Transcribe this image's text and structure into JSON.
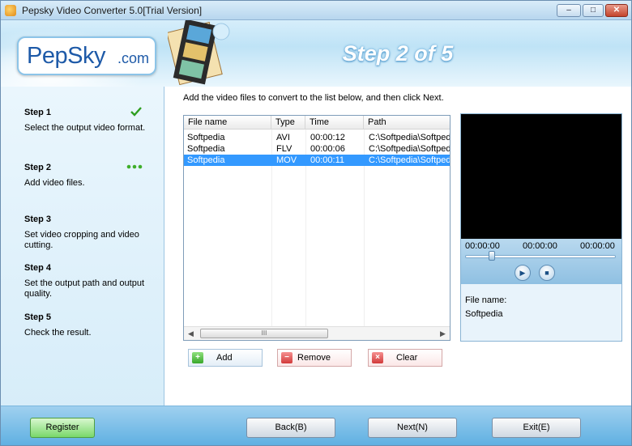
{
  "window": {
    "title": "Pepsky Video Converter 5.0[Trial Version]",
    "controls": {
      "minimize": "–",
      "maximize": "□",
      "close": "✕"
    }
  },
  "banner": {
    "logo": "PepSky",
    "logo_suffix": ".com",
    "step_title": "Step 2 of 5"
  },
  "steps": [
    {
      "title": "Step 1",
      "desc": "Select the output video format.",
      "status_icon": "check-icon"
    },
    {
      "title": "Step 2",
      "desc": "Add video files.",
      "status_icon": "in-progress-dots-icon"
    },
    {
      "title": "Step 3",
      "desc": "Set video cropping and video cutting."
    },
    {
      "title": "Step 4",
      "desc": "Set the output path and output quality."
    },
    {
      "title": "Step 5",
      "desc": "Check the result."
    }
  ],
  "main": {
    "instruction": "Add the video files to convert to the list below, and then click Next.",
    "columns": [
      "File name",
      "Type",
      "Time",
      "Path"
    ],
    "rows": [
      {
        "name": "Softpedia",
        "type": "AVI",
        "time": "00:00:12",
        "path": "C:\\Softpedia\\Softpedia.avi"
      },
      {
        "name": "Softpedia",
        "type": "FLV",
        "time": "00:00:06",
        "path": "C:\\Softpedia\\Softpedia.flv"
      },
      {
        "name": "Softpedia",
        "type": "MOV",
        "time": "00:00:11",
        "path": "C:\\Softpedia\\Softpedia.mov"
      }
    ],
    "scroll_thumb_grip": "III",
    "add_label": "Add",
    "remove_label": "Remove",
    "clear_label": "Clear"
  },
  "player": {
    "time_start": "00:00:00",
    "time_current": "00:00:00",
    "time_end": "00:00:00",
    "play_icon": "play-icon",
    "stop_icon": "stop-icon",
    "file_label": "File name:",
    "file_value": "Softpedia"
  },
  "footer": {
    "register_label": "Register",
    "back_label": "Back(B)",
    "next_label": "Next(N)",
    "exit_label": "Exit(E)"
  },
  "colors": {
    "selection": "#3399ff",
    "banner": "#bfe3f6",
    "bottom_bar": "#5fb0e2",
    "register_green": "#79d86a",
    "step_check": "#2e9e1f"
  }
}
